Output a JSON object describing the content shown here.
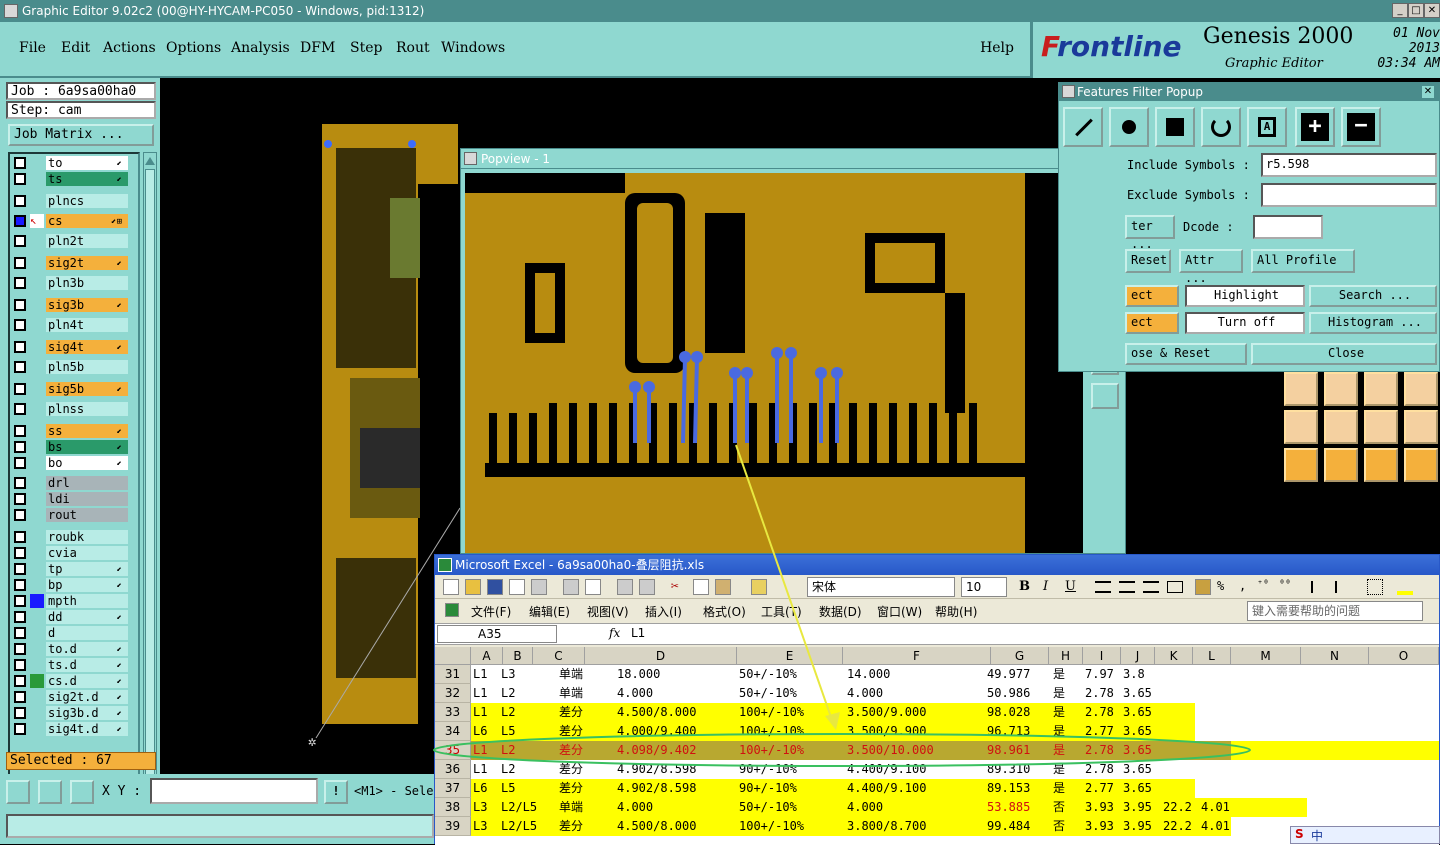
{
  "window": {
    "title": "Graphic Editor 9.02c2 (00@HY-HYCAM-PC050 - Windows, pid:1312)"
  },
  "menu": {
    "items": [
      "File",
      "Edit",
      "Actions",
      "Options",
      "Analysis",
      "DFM",
      "Step",
      "Rout",
      "Windows"
    ],
    "help": "Help"
  },
  "logo": {
    "brand_rest": "rontline",
    "brand_f": "F",
    "product": "Genesis 2000",
    "subtitle": "Graphic Editor",
    "date": "01 Nov 2013",
    "time": "03:34 AM"
  },
  "job": {
    "job_label": "Job : 6a9sa00ha0",
    "step_label": "Step: cam",
    "matrix_button": "Job Matrix ..."
  },
  "layers": [
    {
      "name": "to",
      "style": "white",
      "arrow": "⬋"
    },
    {
      "name": "ts",
      "style": "green",
      "arrow": "⬋"
    },
    {
      "name": "plncs",
      "style": "light",
      "arrow": ""
    },
    {
      "name": "cs",
      "style": "orange",
      "arrow": "⬋⊞",
      "active": true
    },
    {
      "name": "pln2t",
      "style": "light",
      "arrow": ""
    },
    {
      "name": "sig2t",
      "style": "orange",
      "arrow": "⬋"
    },
    {
      "name": "pln3b",
      "style": "light",
      "arrow": ""
    },
    {
      "name": "sig3b",
      "style": "orange",
      "arrow": "⬋"
    },
    {
      "name": "pln4t",
      "style": "light",
      "arrow": ""
    },
    {
      "name": "sig4t",
      "style": "orange",
      "arrow": "⬋"
    },
    {
      "name": "pln5b",
      "style": "light",
      "arrow": ""
    },
    {
      "name": "sig5b",
      "style": "orange",
      "arrow": "⬋"
    },
    {
      "name": "plnss",
      "style": "light",
      "arrow": ""
    },
    {
      "name": "ss",
      "style": "orange",
      "arrow": "⬋"
    },
    {
      "name": "bs",
      "style": "green",
      "arrow": "⬋"
    },
    {
      "name": "bo",
      "style": "white",
      "arrow": "⬋"
    },
    {
      "name": "drl",
      "style": "gray",
      "arrow": ""
    },
    {
      "name": "ldi",
      "style": "gray",
      "arrow": ""
    },
    {
      "name": "rout",
      "style": "gray",
      "arrow": ""
    },
    {
      "name": "roubk",
      "style": "light",
      "arrow": ""
    },
    {
      "name": "cvia",
      "style": "light",
      "arrow": ""
    },
    {
      "name": "tp",
      "style": "light",
      "arrow": "⬋"
    },
    {
      "name": "bp",
      "style": "light",
      "arrow": "⬋"
    },
    {
      "name": "mpth",
      "style": "light",
      "arrow": "",
      "blue": true
    },
    {
      "name": "dd",
      "style": "light",
      "arrow": "⬋"
    },
    {
      "name": "d",
      "style": "light",
      "arrow": ""
    },
    {
      "name": "to.d",
      "style": "light",
      "arrow": "⬋"
    },
    {
      "name": "ts.d",
      "style": "light",
      "arrow": "⬋"
    },
    {
      "name": "cs.d",
      "style": "light",
      "arrow": "⬋",
      "green": true
    },
    {
      "name": "sig2t.d",
      "style": "light",
      "arrow": "⬋"
    },
    {
      "name": "sig3b.d",
      "style": "light",
      "arrow": "⬋"
    },
    {
      "name": "sig4t.d",
      "style": "light",
      "arrow": "⬋"
    }
  ],
  "status": {
    "selected": "Selected : 67",
    "xy_label": "X Y :",
    "xy_value": "",
    "m1_text": "<M1> - Sele"
  },
  "popview": {
    "title": "Popview - 1"
  },
  "features_filter": {
    "title": "Features Filter Popup",
    "include_label": "Include Symbols :",
    "include_value": "r5.598",
    "exclude_label": "Exclude Symbols :",
    "exclude_value": "",
    "filter_btn": "ter ...",
    "dcode_label": "Dcode :",
    "dcode_value": "",
    "reset": "Reset",
    "attr": "Attr ...",
    "all_profile": "All Profile",
    "select1": "ect",
    "highlight": "Highlight",
    "search": "Search ...",
    "select2": "ect",
    "turn_off": "Turn off",
    "histogram": "Histogram ...",
    "close_reset": "ose & Reset",
    "close": "Close"
  },
  "excel": {
    "title": "Microsoft Excel - 6a9sa00ha0-叠层阻抗.xls",
    "font_name": "宋体",
    "font_size": "10",
    "menu": [
      "文件(F)",
      "编辑(E)",
      "视图(V)",
      "插入(I)",
      "格式(O)",
      "工具(T)",
      "数据(D)",
      "窗口(W)",
      "帮助(H)"
    ],
    "help_box": "键入需要帮助的问题",
    "cell_ref": "A35",
    "fx": "fx",
    "formula": "L1",
    "columns": [
      "A",
      "B",
      "C",
      "D",
      "E",
      "F",
      "G",
      "H",
      "I",
      "J",
      "K",
      "L",
      "M",
      "N",
      "O"
    ],
    "rows": [
      {
        "n": "31",
        "c": [
          "L1",
          "L3",
          "单端",
          "18.000",
          "50+/-10%",
          "14.000",
          "49.977",
          "是",
          "7.97",
          "3.8",
          "",
          ""
        ],
        "fill": "none"
      },
      {
        "n": "32",
        "c": [
          "L1",
          "L2",
          "单端",
          "4.000",
          "50+/-10%",
          "4.000",
          "50.986",
          "是",
          "2.78",
          "3.65",
          "",
          ""
        ],
        "fill": "none"
      },
      {
        "n": "33",
        "c": [
          "L1",
          "L2",
          "差分",
          "4.500/8.000",
          "100+/-10%",
          "3.500/9.000",
          "98.028",
          "是",
          "2.78",
          "3.65",
          "",
          ""
        ],
        "fill": "yellow"
      },
      {
        "n": "34",
        "c": [
          "L6",
          "L5",
          "差分",
          "4.000/9.400",
          "100+/-10%",
          "3.500/9.900",
          "96.713",
          "是",
          "2.77",
          "3.65",
          "",
          ""
        ],
        "fill": "yellow"
      },
      {
        "n": "35",
        "c": [
          "L1",
          "L2",
          "差分",
          "4.098/9.402",
          "100+/-10%",
          "3.500/10.000",
          "98.961",
          "是",
          "2.78",
          "3.65",
          "",
          ""
        ],
        "fill": "selected"
      },
      {
        "n": "36",
        "c": [
          "L1",
          "L2",
          "差分",
          "4.902/8.598",
          "90+/-10%",
          "4.400/9.100",
          "89.310",
          "是",
          "2.78",
          "3.65",
          "",
          ""
        ],
        "fill": "none"
      },
      {
        "n": "37",
        "c": [
          "L6",
          "L5",
          "差分",
          "4.902/8.598",
          "90+/-10%",
          "4.400/9.100",
          "89.153",
          "是",
          "2.77",
          "3.65",
          "",
          ""
        ],
        "fill": "yellow"
      },
      {
        "n": "38",
        "c": [
          "L3",
          "L2/L5",
          "单端",
          "4.000",
          "50+/-10%",
          "4.000",
          "53.885",
          "否",
          "3.93",
          "3.95",
          "22.2",
          "4.01"
        ],
        "fill": "yellow",
        "red_g": true
      },
      {
        "n": "39",
        "c": [
          "L3",
          "L2/L5",
          "差分",
          "4.500/8.000",
          "100+/-10%",
          "3.800/8.700",
          "99.484",
          "否",
          "3.93",
          "3.95",
          "22.2",
          "4.01"
        ],
        "fill": "yellow"
      }
    ]
  }
}
